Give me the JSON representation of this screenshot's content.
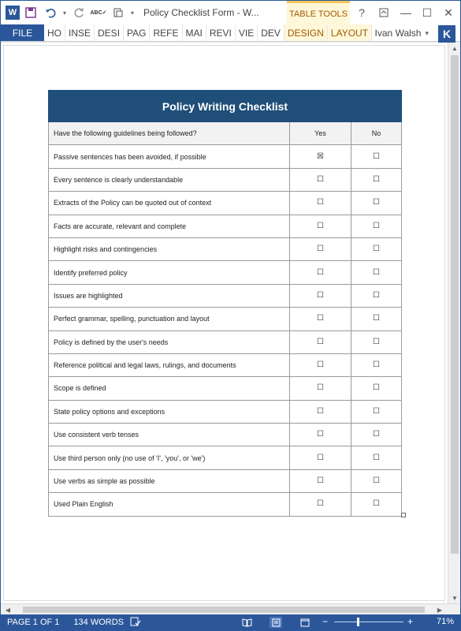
{
  "window": {
    "title": "Policy Checklist Form - W...",
    "context_tab_label": "TABLE TOOLS",
    "help": "?",
    "minimize": "—",
    "maximize": "☐",
    "close": "✕"
  },
  "ribbon": {
    "file": "FILE",
    "tabs": [
      "HO",
      "INSE",
      "DESI",
      "PAG",
      "REFE",
      "MAI",
      "REVI",
      "VIE",
      "DEV"
    ],
    "context_tabs": [
      "DESIGN",
      "LAYOUT"
    ],
    "user_name": "Ivan Walsh",
    "avatar_letter": "K"
  },
  "document": {
    "table_title": "Policy Writing Checklist",
    "header": {
      "question": "Have the following guidelines being followed?",
      "yes": "Yes",
      "no": "No"
    },
    "rows": [
      {
        "text": "Passive sentences has been avoided, if possible",
        "yes": "☒",
        "no": "☐"
      },
      {
        "text": "Every sentence is clearly understandable",
        "yes": "☐",
        "no": "☐"
      },
      {
        "text": "Extracts of the Policy can be quoted out of context",
        "yes": "☐",
        "no": "☐"
      },
      {
        "text": "Facts are accurate, relevant and complete",
        "yes": "☐",
        "no": "☐"
      },
      {
        "text": "Highlight risks and contingencies",
        "yes": "☐",
        "no": "☐"
      },
      {
        "text": "Identify preferred policy",
        "yes": "☐",
        "no": "☐"
      },
      {
        "text": "Issues are highlighted",
        "yes": "☐",
        "no": "☐"
      },
      {
        "text": "Perfect grammar, spelling, punctuation and layout",
        "yes": "☐",
        "no": "☐"
      },
      {
        "text": "Policy is defined by the user's needs",
        "yes": "☐",
        "no": "☐"
      },
      {
        "text": "Reference political and legal laws, rulings, and documents",
        "yes": "☐",
        "no": "☐"
      },
      {
        "text": "Scope is defined",
        "yes": "☐",
        "no": "☐"
      },
      {
        "text": "State policy options and exceptions",
        "yes": "☐",
        "no": "☐"
      },
      {
        "text": "Use consistent verb tenses",
        "yes": "☐",
        "no": "☐"
      },
      {
        "text": "Use third person only (no use of 'I', 'you', or 'we')",
        "yes": "☐",
        "no": "☐"
      },
      {
        "text": "Use verbs as simple as possible",
        "yes": "☐",
        "no": "☐"
      },
      {
        "text": "Used Plain English",
        "yes": "☐",
        "no": "☐"
      }
    ]
  },
  "status": {
    "page": "PAGE 1 OF 1",
    "words": "134 WORDS",
    "zoom": "71%",
    "zoom_minus": "−",
    "zoom_plus": "+"
  },
  "colors": {
    "accent": "#2b579a",
    "table_header": "#1f4e79",
    "context_tab": "#fff7d9"
  }
}
